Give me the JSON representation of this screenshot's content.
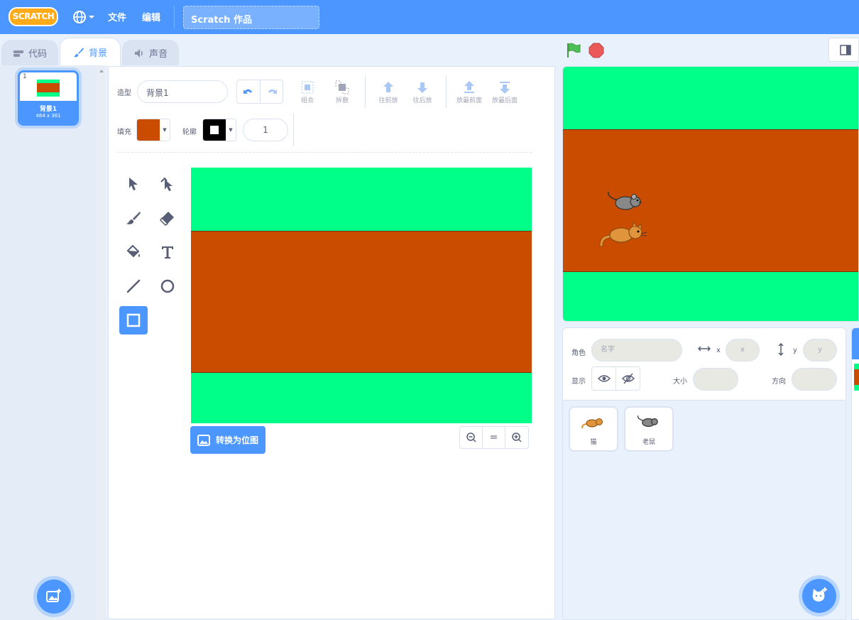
{
  "menubar": {
    "logo": "SCRATCH",
    "file": "文件",
    "edit": "编辑",
    "project_title": "Scratch 作品"
  },
  "tabs": [
    {
      "label": "代码",
      "icon": "code-icon"
    },
    {
      "label": "背景",
      "icon": "brush-icon"
    },
    {
      "label": "声音",
      "icon": "speaker-icon"
    }
  ],
  "costume_list": {
    "items": [
      {
        "number": "1",
        "name": "背景1",
        "size": "484 x 361"
      }
    ]
  },
  "paint": {
    "costume_label": "造型",
    "costume_name": "背景1",
    "group": "组合",
    "ungroup": "拆散",
    "forward": "往前放",
    "backward": "往后放",
    "front": "放最前面",
    "back": "放最后面",
    "fill_label": "填充",
    "fill_color": "#c94c00",
    "outline_label": "轮廓",
    "outline_color": "#000000",
    "outline_width": "1",
    "convert_button": "转换为位图",
    "zoom_reset": "="
  },
  "backdrop_colors": {
    "green": "#00ff88",
    "brown": "#c94c00"
  },
  "sprite_info": {
    "sprite_label": "角色",
    "name_placeholder": "名字",
    "x_label": "x",
    "x_placeholder": "x",
    "y_label": "y",
    "y_placeholder": "y",
    "show_label": "显示",
    "size_label": "大小",
    "direction_label": "方向"
  },
  "sprites": [
    {
      "name": "猫"
    },
    {
      "name": "老鼠"
    }
  ],
  "accent": "#4c97ff"
}
